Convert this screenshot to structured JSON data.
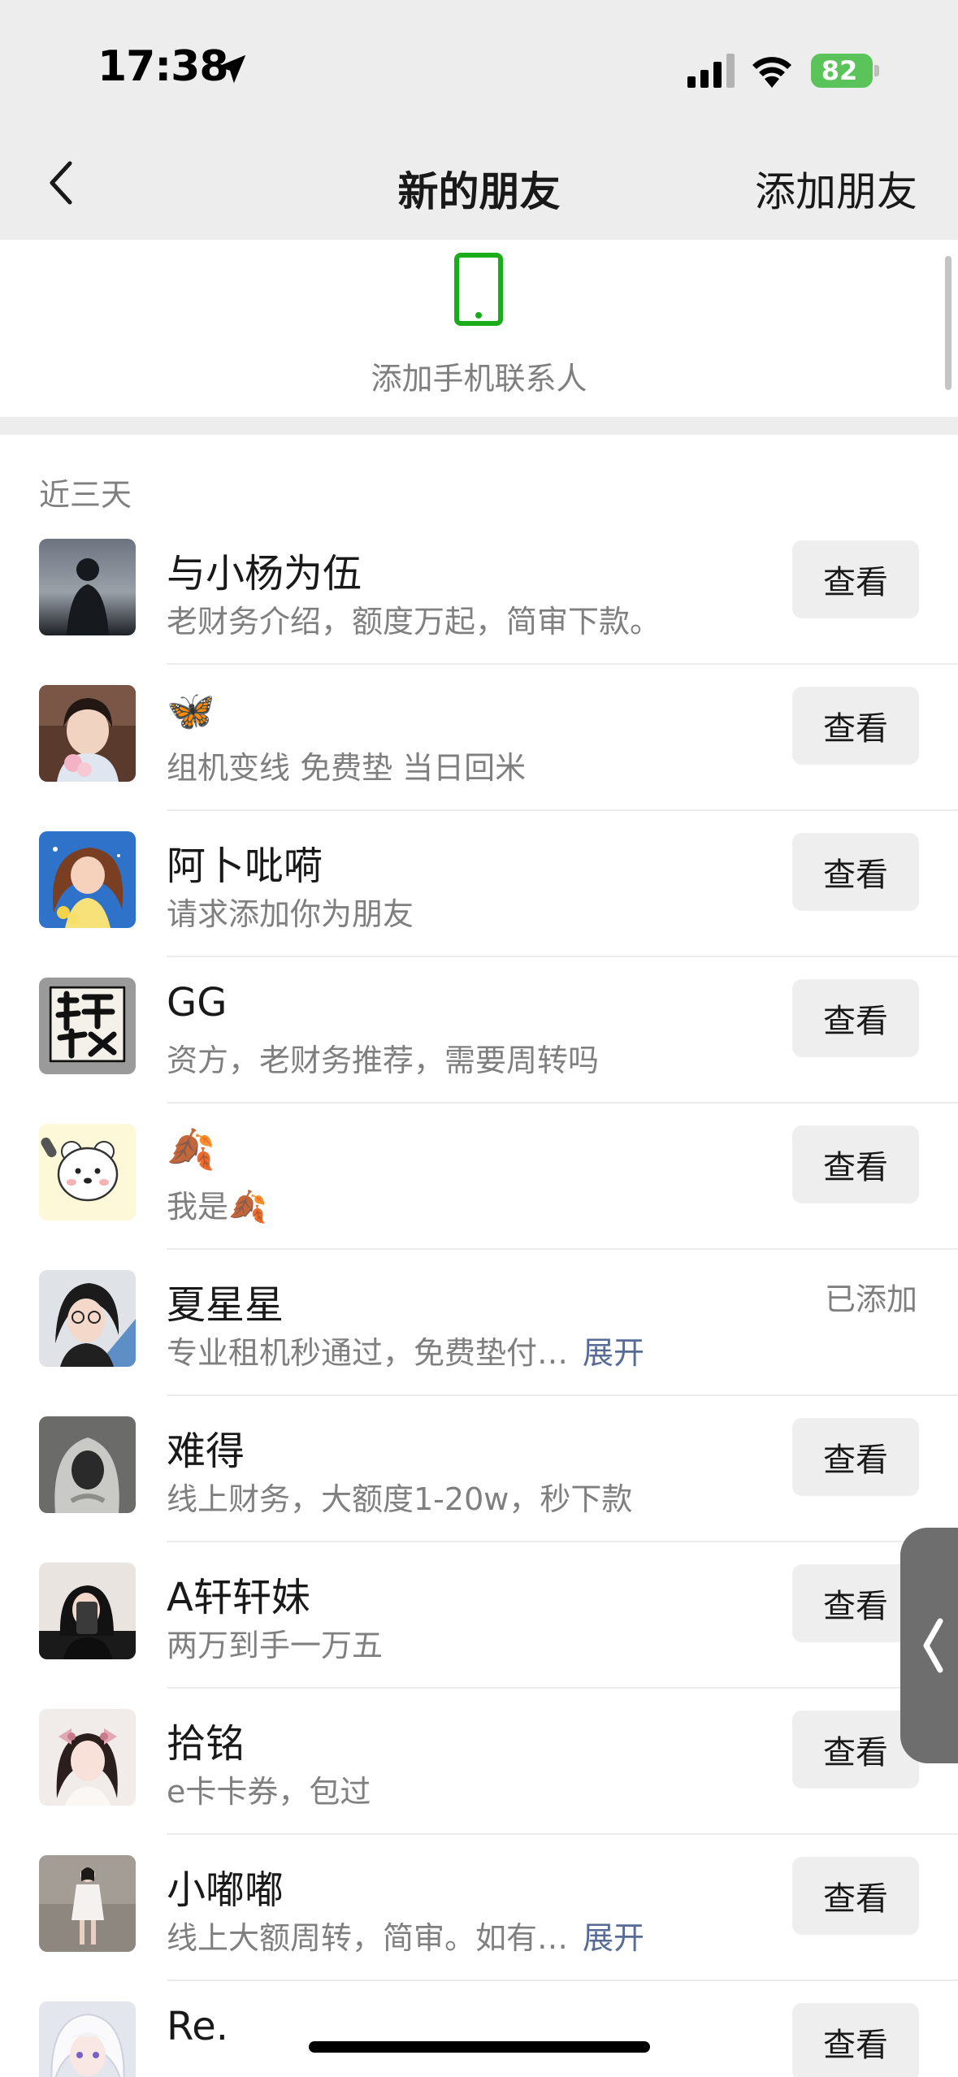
{
  "status_bar": {
    "time": "17:38",
    "battery": "82",
    "icons": [
      "location-arrow-icon",
      "signal-icon",
      "wifi-icon",
      "battery-icon"
    ]
  },
  "nav": {
    "title": "新的朋友",
    "action": "添加朋友",
    "back_icon": "chevron-left-icon"
  },
  "add_phone": {
    "label": "添加手机联系人",
    "icon": "phone-icon",
    "accent": "#1aad19"
  },
  "section": {
    "title": "近三天"
  },
  "labels": {
    "view": "查看",
    "added": "已添加",
    "expand": "展开"
  },
  "requests": [
    {
      "name": "与小杨为伍",
      "message": "老财务介绍，额度万起，简审下款。",
      "status": "view",
      "expand": false,
      "avatar": "silhouette"
    },
    {
      "name": "🦋",
      "message": "组机变线 免费垫 当日回米",
      "status": "view",
      "expand": false,
      "avatar": "portrait-flowers"
    },
    {
      "name": "阿卜吡嗬",
      "message": "请求添加你为朋友",
      "status": "view",
      "expand": false,
      "avatar": "illustration-girl"
    },
    {
      "name": "GG",
      "message": "资方，老财务推荐，需要周转吗",
      "status": "view",
      "expand": false,
      "avatar": "calligraphy"
    },
    {
      "name": "🍂",
      "message": "我是🍂",
      "status": "view",
      "expand": false,
      "avatar": "cartoon-bear"
    },
    {
      "name": "夏星星",
      "message": "专业租机秒通过，免费垫付…",
      "status": "added",
      "expand": true,
      "avatar": "portrait-glasses"
    },
    {
      "name": "难得",
      "message": "线上财务，大额度1-20w，秒下款",
      "status": "view",
      "expand": false,
      "avatar": "hooded-figure"
    },
    {
      "name": "A轩轩妹",
      "message": "两万到手一万五",
      "status": "view",
      "expand": false,
      "avatar": "selfie-dark"
    },
    {
      "name": "拾铭",
      "message": "e卡卡券，包过",
      "status": "view",
      "expand": false,
      "avatar": "girl-bows"
    },
    {
      "name": "小嘟嘟",
      "message": "线上大额周转，简审。如有…",
      "status": "view",
      "expand": true,
      "avatar": "full-body"
    },
    {
      "name": "Re.",
      "message": "",
      "status": "view",
      "expand": false,
      "avatar": "anime-white-hair"
    }
  ]
}
